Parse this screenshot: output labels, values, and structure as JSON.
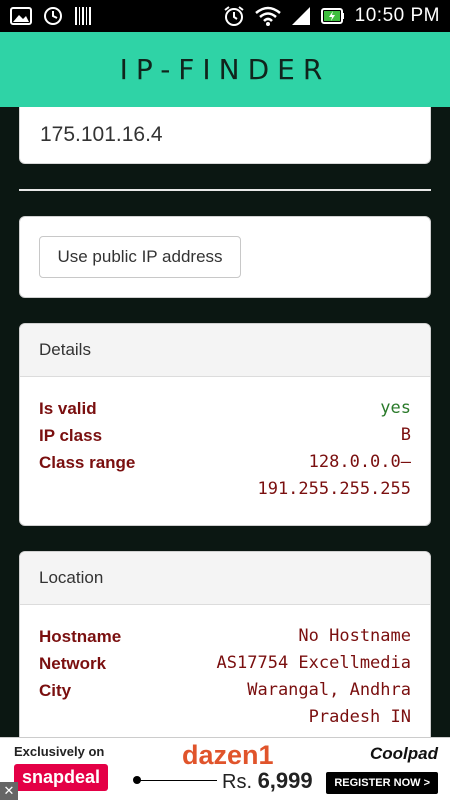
{
  "status_bar": {
    "time": "10:50 PM",
    "left_icons": [
      "image-icon",
      "sync-icon",
      "barcode-icon"
    ],
    "right_icons": [
      "alarm-icon",
      "wifi-icon",
      "signal-icon",
      "battery-charging-icon"
    ]
  },
  "app": {
    "title": "IP-FINDER"
  },
  "ip_input": {
    "value": "175.101.16.4"
  },
  "actions": {
    "public_ip_label": "Use public IP address"
  },
  "details": {
    "title": "Details",
    "rows": [
      {
        "key": "Is valid",
        "value": "yes"
      },
      {
        "key": "IP class",
        "value": "B"
      },
      {
        "key": "Class range",
        "value": "128.0.0.0– 191.255.255.255"
      }
    ]
  },
  "location": {
    "title": "Location",
    "rows": [
      {
        "key": "Hostname",
        "value": "No Hostname"
      },
      {
        "key": "Network",
        "value": "AS17754 Excellmedia"
      },
      {
        "key": "City",
        "value": "Warangal, Andhra Pradesh IN"
      }
    ]
  },
  "ad": {
    "exclusive": "Exclusively on",
    "snapdeal": "snapdeal",
    "brand": "dazen1",
    "price_prefix": "Rs.",
    "price": "6,999",
    "coolpad": "Coolpad",
    "register": "REGISTER NOW >",
    "close": "✕"
  },
  "colors": {
    "appbar": "#2fd3a6",
    "background": "#0b1712",
    "key_text": "#7a0f0f",
    "valid_text": "#2a7a2a"
  }
}
